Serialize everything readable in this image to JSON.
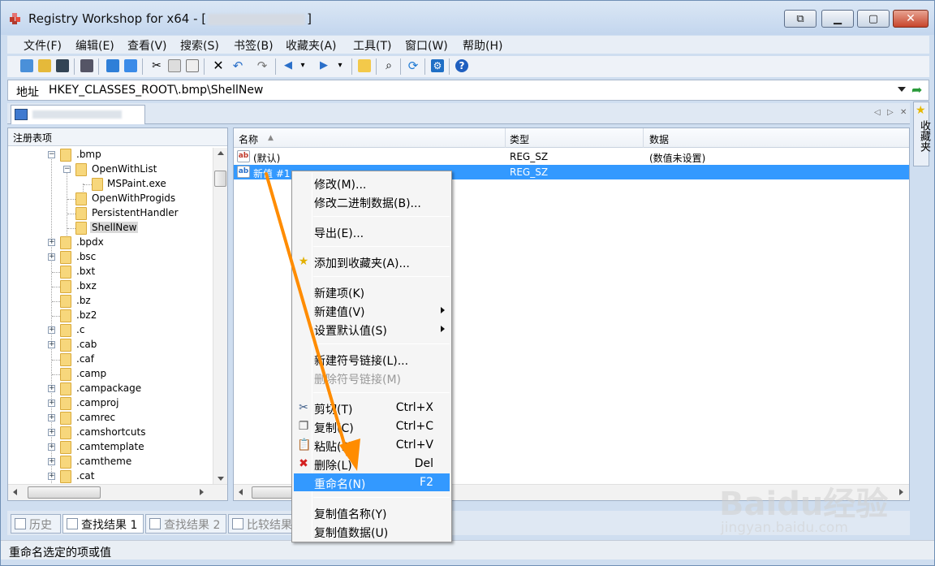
{
  "window": {
    "title_prefix": "Registry Workshop for x64 - [",
    "title_suffix": "]"
  },
  "menubar": [
    {
      "label": "文件(F)"
    },
    {
      "label": "编辑(E)"
    },
    {
      "label": "查看(V)"
    },
    {
      "label": "搜索(S)"
    },
    {
      "label": "书签(B)"
    },
    {
      "label": "收藏夹(A)"
    },
    {
      "label": "工具(T)"
    },
    {
      "label": "窗口(W)"
    },
    {
      "label": "帮助(H)"
    }
  ],
  "address": {
    "label": "地址",
    "value": "HKEY_CLASSES_ROOT\\.bmp\\ShellNew"
  },
  "favorites_side_label": "收藏夹",
  "left_pane": {
    "header": "注册表项",
    "tree": [
      {
        "label": ".bmp"
      },
      {
        "label": "OpenWithList"
      },
      {
        "label": "MSPaint.exe"
      },
      {
        "label": "OpenWithProgids"
      },
      {
        "label": "PersistentHandler"
      },
      {
        "label": "ShellNew"
      },
      {
        "label": ".bpdx"
      },
      {
        "label": ".bsc"
      },
      {
        "label": ".bxt"
      },
      {
        "label": ".bxz"
      },
      {
        "label": ".bz"
      },
      {
        "label": ".bz2"
      },
      {
        "label": ".c"
      },
      {
        "label": ".cab"
      },
      {
        "label": ".caf"
      },
      {
        "label": ".camp"
      },
      {
        "label": ".campackage"
      },
      {
        "label": ".camproj"
      },
      {
        "label": ".camrec"
      },
      {
        "label": ".camshortcuts"
      },
      {
        "label": ".camtemplate"
      },
      {
        "label": ".camtheme"
      },
      {
        "label": ".cat"
      }
    ]
  },
  "right_pane": {
    "columns": {
      "name": "名称",
      "type": "类型",
      "data": "数据"
    },
    "rows": [
      {
        "icon": "ab",
        "name": "(默认)",
        "type": "REG_SZ",
        "data": "(数值未设置)"
      },
      {
        "icon": "ab",
        "name": "新值 #1",
        "type": "REG_SZ",
        "data": ""
      }
    ]
  },
  "context_menu": {
    "items": [
      {
        "label": "修改(M)..."
      },
      {
        "label": "修改二进制数据(B)..."
      },
      {
        "label": "导出(E)..."
      },
      {
        "label": "添加到收藏夹(A)..."
      },
      {
        "label": "新建项(K)"
      },
      {
        "label": "新建值(V)"
      },
      {
        "label": "设置默认值(S)"
      },
      {
        "label": "新建符号链接(L)..."
      },
      {
        "label": "删除符号链接(M)"
      },
      {
        "label": "剪切(T)",
        "shortcut": "Ctrl+X"
      },
      {
        "label": "复制(C)",
        "shortcut": "Ctrl+C"
      },
      {
        "label": "粘贴(P)",
        "shortcut": "Ctrl+V"
      },
      {
        "label": "删除(L)",
        "shortcut": "Del"
      },
      {
        "label": "重命名(N)",
        "shortcut": "F2"
      },
      {
        "label": "复制值名称(Y)"
      },
      {
        "label": "复制值数据(U)"
      }
    ]
  },
  "bottom_tabs": [
    {
      "label": "历史"
    },
    {
      "label": "查找结果 1"
    },
    {
      "label": "查找结果 2"
    },
    {
      "label": "比较结果"
    }
  ],
  "status": "重命名选定的项或值",
  "watermark": {
    "text": "Baidu经验",
    "url": "jingyan.baidu.com"
  },
  "colors": {
    "selection": "#3399ff",
    "annotation_arrow": "#ff8c00",
    "close_button": "#c7452c"
  }
}
